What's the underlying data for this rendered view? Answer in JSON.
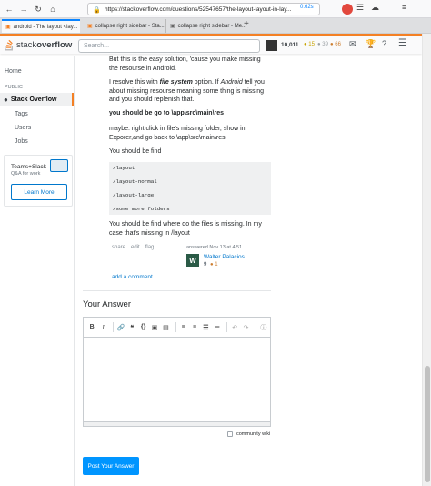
{
  "browser": {
    "url": "https://stackoverflow.com/questions/52547657/the-layout-layout-in-lay...",
    "zoom_badge": "0.62s",
    "tabs": [
      {
        "label": "android - The layout <lay...",
        "active": true
      },
      {
        "label": "collapse right sidebar - Sta...",
        "active": false
      },
      {
        "label": "collapse right sidebar - Me...",
        "active": false
      }
    ],
    "new_tab": "+"
  },
  "header": {
    "logo_a": "stack",
    "logo_b": "overflow",
    "search_placeholder": "Search...",
    "reputation": "10,011",
    "gold": "● 15",
    "silver": "● 39",
    "bronze": "● 66"
  },
  "sidebar": {
    "home": "Home",
    "public_heading": "PUBLIC",
    "items": [
      {
        "label": "Stack Overflow",
        "active": true
      },
      {
        "label": "Tags",
        "active": false
      },
      {
        "label": "Users",
        "active": false
      },
      {
        "label": "Jobs",
        "active": false
      }
    ],
    "teams": {
      "title": "Teams+Slack",
      "subtitle": "Q&A for work",
      "button": "Learn More"
    }
  },
  "answer": {
    "p1": "But this is the easy solution, 'cause you make missing the resourse in Android.",
    "p2_a": "I resolve this with ",
    "p2_em": "file system",
    "p2_b": " option. If ",
    "p2_em2": "Android",
    "p2_c": " tell you about missing resourse meaning some thing is missing and you should replenish that.",
    "p3": "you should be go to \\app\\src\\main\\res",
    "p4": "maybe: right click in file's missing folder, show in Exporer,and go back to \\app\\src\\main\\res",
    "p5": "You should be find",
    "code_lines": [
      "/layout",
      "/layout-normal",
      "/layout-large",
      "/some more folders"
    ],
    "p6": "You should be find where do the files is missing. In my case that's missing in /layout",
    "menu": [
      "share",
      "edit",
      "flag"
    ],
    "answered": "answered Nov 13 at 4:51",
    "user_name": "Walter Palacios",
    "user_initial": "W",
    "user_rep": "9",
    "user_badges": "● 1",
    "add_comment": "add a comment"
  },
  "your_answer": {
    "heading": "Your Answer",
    "toolbar_icons": [
      "bold-icon",
      "italic-icon",
      "link-icon",
      "quote-icon",
      "code-icon",
      "image-icon",
      "snippet-icon",
      "ordered-list-icon",
      "unordered-list-icon",
      "heading-icon",
      "hr-icon",
      "undo-icon",
      "redo-icon",
      "help-icon"
    ],
    "community_wiki": "community wiki",
    "post_button": "Post Your Answer"
  }
}
